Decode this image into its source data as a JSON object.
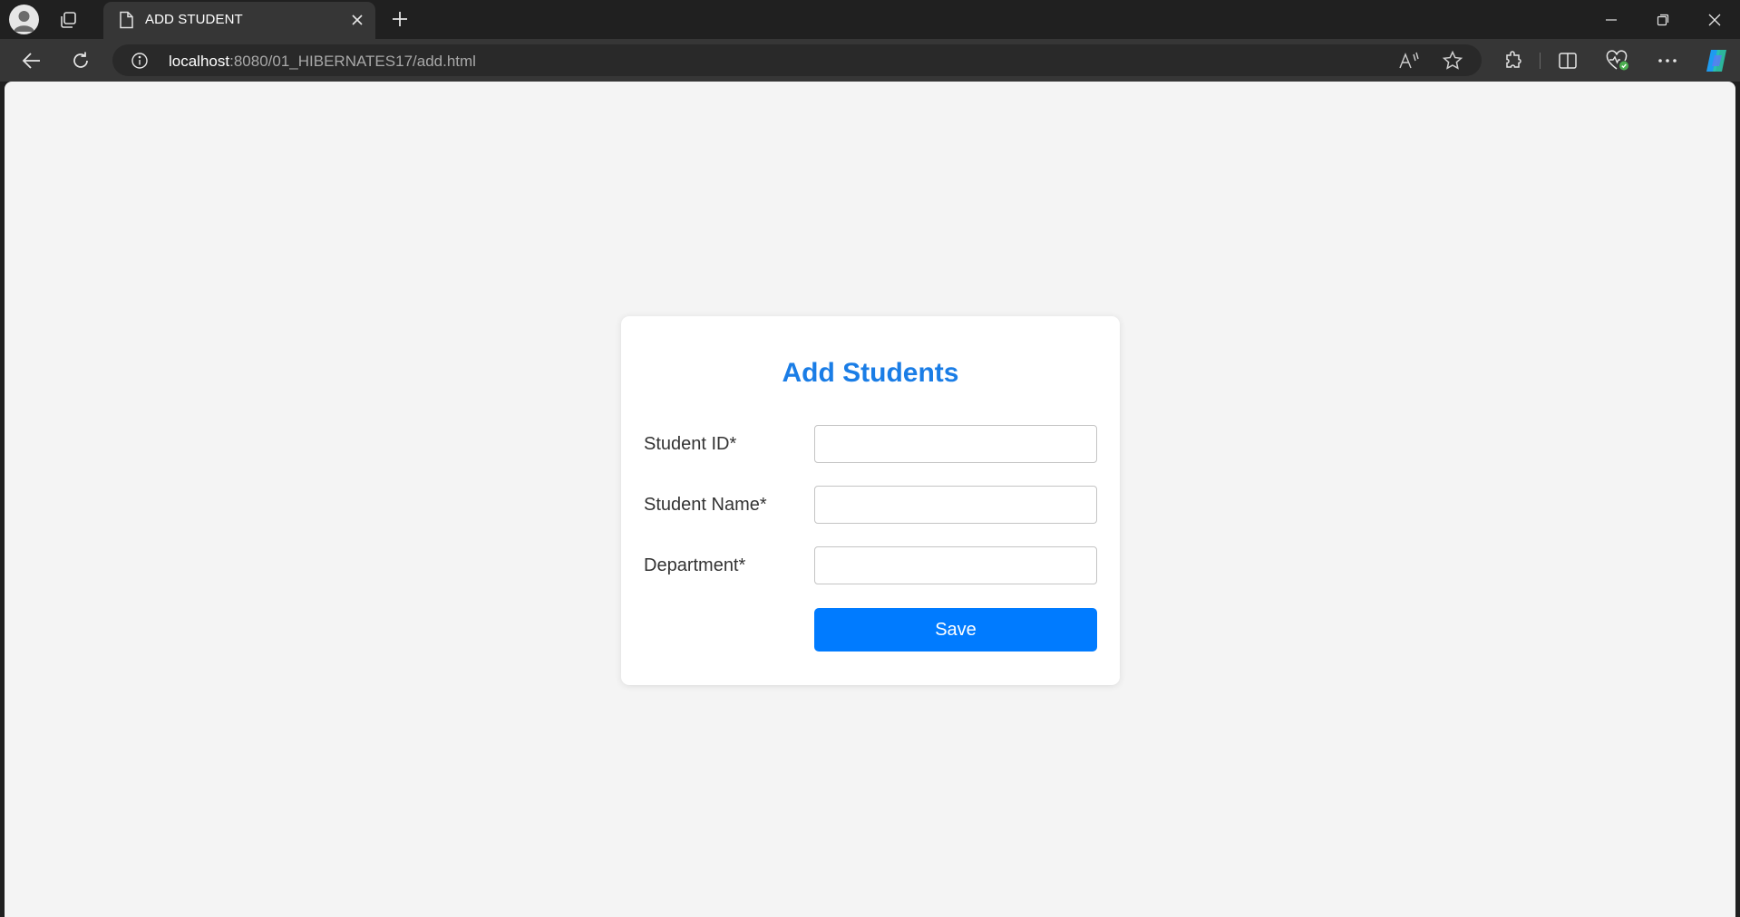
{
  "browser": {
    "tab": {
      "title": "ADD STUDENT"
    },
    "address": {
      "host": "localhost",
      "path": ":8080/01_HIBERNATES17/add.html"
    },
    "accent": "#1a7de6"
  },
  "form": {
    "heading": "Add Students",
    "fields": [
      {
        "label": "Student ID*",
        "value": "",
        "placeholder": ""
      },
      {
        "label": "Student Name*",
        "value": "",
        "placeholder": ""
      },
      {
        "label": "Department*",
        "value": "",
        "placeholder": ""
      }
    ],
    "save_label": "Save",
    "button_color": "#007bff"
  }
}
